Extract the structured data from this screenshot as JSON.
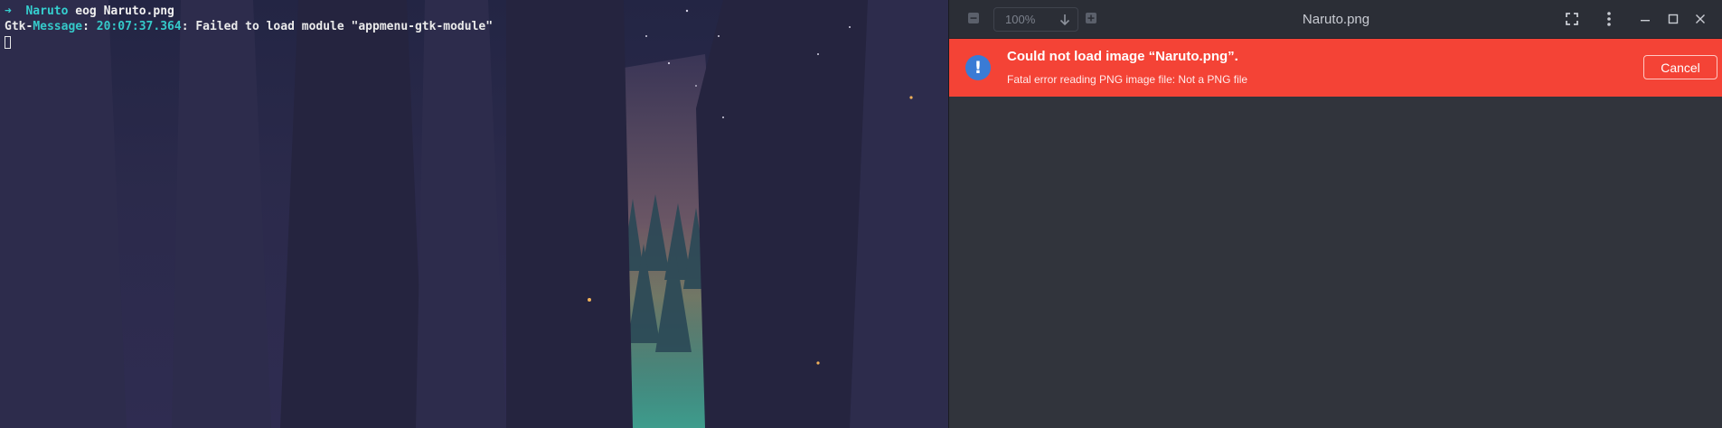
{
  "terminal": {
    "prompt_arrow": "➜",
    "prompt_dir": "Naruto",
    "command": "eog Naruto.png",
    "message_prefix": "Gtk",
    "message_dash": "-",
    "message_label": "Message",
    "message_colon": ": ",
    "message_time": "20:07:37.364",
    "message_text": ": Failed to load module \"appmenu-gtk-module\""
  },
  "viewer": {
    "title": "Naruto.png",
    "zoom_value": "100%",
    "error": {
      "title": "Could not load image “Naruto.png”.",
      "detail": "Fatal error reading PNG image file: Not a PNG file",
      "icon_glyph": "!",
      "cancel_label": "Cancel"
    }
  },
  "icons": {
    "zoom_out": "zoom-out-icon",
    "zoom_dropdown": "arrow-down-icon",
    "zoom_in": "zoom-in-icon",
    "fullscreen": "fullscreen-icon",
    "menu": "kebab-menu-icon",
    "minimize": "minimize-icon",
    "maximize": "maximize-icon",
    "close": "close-icon",
    "error": "error-icon"
  },
  "colors": {
    "error_bar": "#f44336",
    "error_icon": "#3a7bd5",
    "viewer_bg": "#31343c",
    "terminal_cyan": "#35d0d0"
  }
}
